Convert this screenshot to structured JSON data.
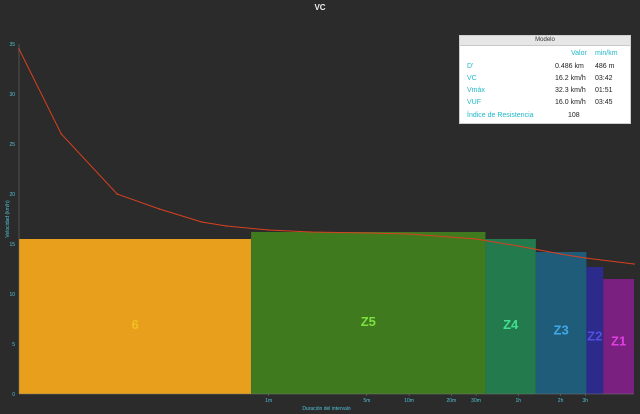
{
  "title": "VC",
  "chart_data": {
    "type": "area",
    "title": "VC",
    "xlabel": "Duración del intervalo",
    "ylabel": "Velocidad (km/h)",
    "x_scale": "log",
    "x_ticks": [
      {
        "label": "1m",
        "seconds": 60
      },
      {
        "label": "5m",
        "seconds": 300
      },
      {
        "label": "10m",
        "seconds": 600
      },
      {
        "label": "20m",
        "seconds": 1200
      },
      {
        "label": "30m",
        "seconds": 1800
      },
      {
        "label": "1h",
        "seconds": 3600
      },
      {
        "label": "2h",
        "seconds": 7200
      },
      {
        "label": "3h",
        "seconds": 10800
      }
    ],
    "y_ticks": [
      "0",
      "5",
      "10",
      "15",
      "20",
      "25",
      "30",
      "35"
    ],
    "ylim": [
      0,
      35
    ],
    "zones": [
      {
        "name": "6",
        "color": "#e8a01c",
        "label_color": "#f0c020",
        "x_start": 1,
        "x_end": 45,
        "y": 15.5
      },
      {
        "name": "Z5",
        "color": "#3f7a1e",
        "label_color": "#7be040",
        "x_start": 45,
        "x_end": 2100,
        "y": 16.2
      },
      {
        "name": "Z4",
        "color": "#237a4c",
        "label_color": "#40e090",
        "x_start": 2100,
        "x_end": 4800,
        "y": 15.5
      },
      {
        "name": "Z3",
        "color": "#1e5c7a",
        "label_color": "#40a8e8",
        "x_start": 4800,
        "x_end": 11000,
        "y": 14.2
      },
      {
        "name": "Z2",
        "color": "#2c2a8a",
        "label_color": "#5050e0",
        "x_start": 11000,
        "x_end": 14500,
        "y": 12.7
      },
      {
        "name": "Z1",
        "color": "#7a2080",
        "label_color": "#e040e0",
        "x_start": 14500,
        "x_end": 24000,
        "y": 11.5
      }
    ],
    "series": [
      {
        "name": "VC",
        "color": "#d94020",
        "x": [
          1,
          2,
          5,
          10,
          20,
          30,
          60,
          120,
          300,
          600,
          1800,
          3600,
          7200,
          10800,
          24000
        ],
        "y": [
          34.5,
          26,
          20,
          18.5,
          17.2,
          16.8,
          16.4,
          16.2,
          16.1,
          16.0,
          15.5,
          14.8,
          14.0,
          13.6,
          13.0
        ]
      }
    ],
    "grid": false
  },
  "legend": {
    "header": "Modelo",
    "col_value": "Valor",
    "col_minkm": "min/km",
    "rows": [
      {
        "label": "D'",
        "value": "0.486 km",
        "minkm": "486 m"
      },
      {
        "label": "VC",
        "value": "16.2 km/h",
        "minkm": "03:42"
      },
      {
        "label": "Vmáx",
        "value": "32.3 km/h",
        "minkm": "01:51"
      },
      {
        "label": "VUF",
        "value": "16.0 km/h",
        "minkm": "03:45"
      },
      {
        "label": "Índice de Resistencia",
        "value": "108",
        "minkm": ""
      }
    ]
  }
}
